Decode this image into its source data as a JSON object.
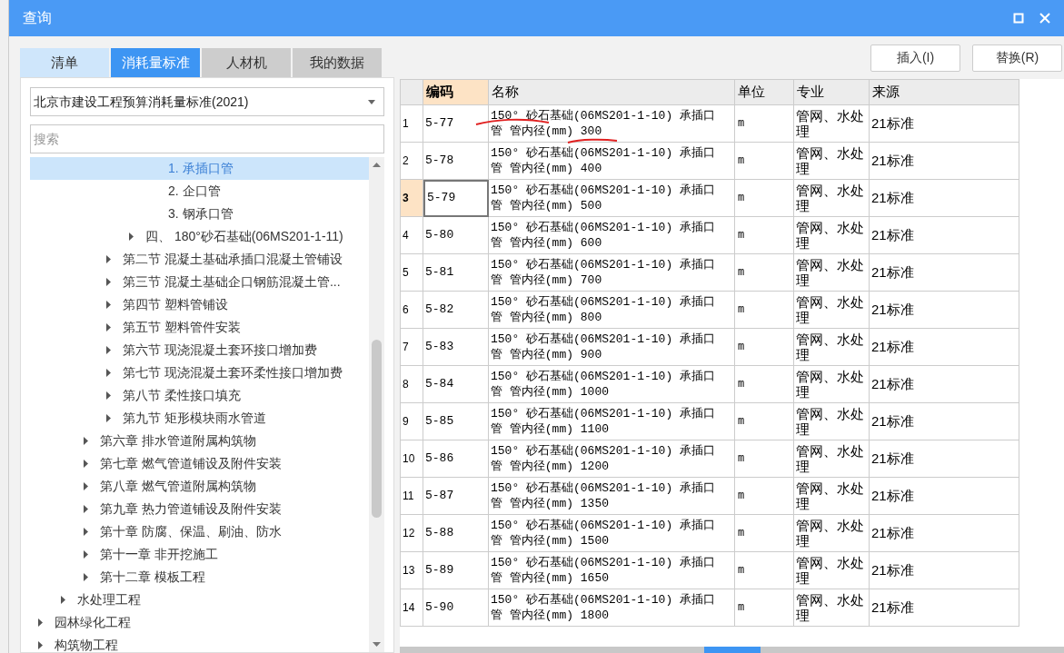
{
  "window": {
    "title": "查询"
  },
  "tabs": [
    {
      "label": "清单",
      "selected": false,
      "highlighted": true
    },
    {
      "label": "消耗量标准",
      "selected": true,
      "highlighted": false
    },
    {
      "label": "人材机",
      "selected": false,
      "highlighted": false
    },
    {
      "label": "我的数据",
      "selected": false,
      "highlighted": false
    }
  ],
  "library_select": {
    "value": "北京市建设工程预算消耗量标准(2021)"
  },
  "search": {
    "placeholder": "搜索"
  },
  "tree": [
    {
      "children": [
        {
          "children": [
            {
              "children": [
                {
                  "children": [
                    {
                      "children": [
                        {
                          "label": "1. 承插口管",
                          "selected": true
                        },
                        {
                          "label": "2. 企口管",
                          "selected": false
                        },
                        {
                          "label": "3. 钢承口管",
                          "selected": false
                        }
                      ]
                    },
                    {
                      "label": "四、 180°砂石基础(06MS201-1-11)",
                      "selected": false,
                      "expanded": false
                    }
                  ]
                },
                {
                  "label": "第二节 混凝土基础承插口混凝土管铺设",
                  "selected": false,
                  "expanded": false
                },
                {
                  "label": "第三节 混凝土基础企口钢筋混凝土管...",
                  "selected": false,
                  "expanded": false
                },
                {
                  "label": "第四节 塑料管铺设",
                  "selected": false,
                  "expanded": false
                },
                {
                  "label": "第五节 塑料管件安装",
                  "selected": false,
                  "expanded": false
                },
                {
                  "label": "第六节 现浇混凝土套环接口增加费",
                  "selected": false,
                  "expanded": false
                },
                {
                  "label": "第七节 现浇混凝土套环柔性接口增加费",
                  "selected": false,
                  "expanded": false
                },
                {
                  "label": "第八节 柔性接口填充",
                  "selected": false,
                  "expanded": false
                },
                {
                  "label": "第九节 矩形模块雨水管道",
                  "selected": false,
                  "expanded": false
                }
              ]
            },
            {
              "label": "第六章 排水管道附属构筑物",
              "selected": false,
              "expanded": false
            },
            {
              "label": "第七章 燃气管道铺设及附件安装",
              "selected": false,
              "expanded": false
            },
            {
              "label": "第八章 燃气管道附属构筑物",
              "selected": false,
              "expanded": false
            },
            {
              "label": "第九章 热力管道铺设及附件安装",
              "selected": false,
              "expanded": false
            },
            {
              "label": "第十章 防腐、保温、刷油、防水",
              "selected": false,
              "expanded": false
            },
            {
              "label": "第十一章 非开挖施工",
              "selected": false,
              "expanded": false
            },
            {
              "label": "第十二章 模板工程",
              "selected": false,
              "expanded": false
            }
          ]
        },
        {
          "label": "水处理工程",
          "selected": false,
          "expanded": false
        }
      ]
    },
    {
      "label": "园林绿化工程",
      "selected": false,
      "expanded": false
    },
    {
      "label": "构筑物工程",
      "selected": false,
      "expanded": false
    }
  ],
  "buttons": [
    "插入(I)",
    "替换(R)"
  ],
  "table": {
    "columns": [
      {
        "label": "编码",
        "selected": true
      },
      {
        "label": "名称",
        "selected": false
      },
      {
        "label": "单位",
        "selected": false
      },
      {
        "label": "专业",
        "selected": false
      },
      {
        "label": "来源",
        "selected": false
      }
    ],
    "rows": [
      {
        "index": "1",
        "code": "5-77",
        "name": "150° 砂石基础(06MS201-1-10) 承插口管 管内径(mm) 300",
        "unit": "m",
        "major": "管网、水处理",
        "source": "21标准",
        "selected": false
      },
      {
        "index": "2",
        "code": "5-78",
        "name": "150° 砂石基础(06MS201-1-10) 承插口管 管内径(mm) 400",
        "unit": "m",
        "major": "管网、水处理",
        "source": "21标准",
        "selected": false
      },
      {
        "index": "3",
        "code": "5-79",
        "name": "150° 砂石基础(06MS201-1-10) 承插口管 管内径(mm) 500",
        "unit": "m",
        "major": "管网、水处理",
        "source": "21标准",
        "selected": true
      },
      {
        "index": "4",
        "code": "5-80",
        "name": "150° 砂石基础(06MS201-1-10) 承插口管 管内径(mm) 600",
        "unit": "m",
        "major": "管网、水处理",
        "source": "21标准",
        "selected": false
      },
      {
        "index": "5",
        "code": "5-81",
        "name": "150° 砂石基础(06MS201-1-10) 承插口管 管内径(mm) 700",
        "unit": "m",
        "major": "管网、水处理",
        "source": "21标准",
        "selected": false
      },
      {
        "index": "6",
        "code": "5-82",
        "name": "150° 砂石基础(06MS201-1-10) 承插口管 管内径(mm) 800",
        "unit": "m",
        "major": "管网、水处理",
        "source": "21标准",
        "selected": false
      },
      {
        "index": "7",
        "code": "5-83",
        "name": "150° 砂石基础(06MS201-1-10) 承插口管 管内径(mm) 900",
        "unit": "m",
        "major": "管网、水处理",
        "source": "21标准",
        "selected": false
      },
      {
        "index": "8",
        "code": "5-84",
        "name": "150° 砂石基础(06MS201-1-10) 承插口管 管内径(mm) 1000",
        "unit": "m",
        "major": "管网、水处理",
        "source": "21标准",
        "selected": false
      },
      {
        "index": "9",
        "code": "5-85",
        "name": "150° 砂石基础(06MS201-1-10) 承插口管 管内径(mm) 1100",
        "unit": "m",
        "major": "管网、水处理",
        "source": "21标准",
        "selected": false
      },
      {
        "index": "10",
        "code": "5-86",
        "name": "150° 砂石基础(06MS201-1-10) 承插口管 管内径(mm) 1200",
        "unit": "m",
        "major": "管网、水处理",
        "source": "21标准",
        "selected": false
      },
      {
        "index": "11",
        "code": "5-87",
        "name": "150° 砂石基础(06MS201-1-10) 承插口管 管内径(mm) 1350",
        "unit": "m",
        "major": "管网、水处理",
        "source": "21标准",
        "selected": false
      },
      {
        "index": "12",
        "code": "5-88",
        "name": "150° 砂石基础(06MS201-1-10) 承插口管 管内径(mm) 1500",
        "unit": "m",
        "major": "管网、水处理",
        "source": "21标准",
        "selected": false
      },
      {
        "index": "13",
        "code": "5-89",
        "name": "150° 砂石基础(06MS201-1-10) 承插口管 管内径(mm) 1650",
        "unit": "m",
        "major": "管网、水处理",
        "source": "21标准",
        "selected": false
      },
      {
        "index": "14",
        "code": "5-90",
        "name": "150° 砂石基础(06MS201-1-10) 承插口管 管内径(mm) 1800",
        "unit": "m",
        "major": "管网、水处理",
        "source": "21标准",
        "selected": false
      }
    ]
  }
}
